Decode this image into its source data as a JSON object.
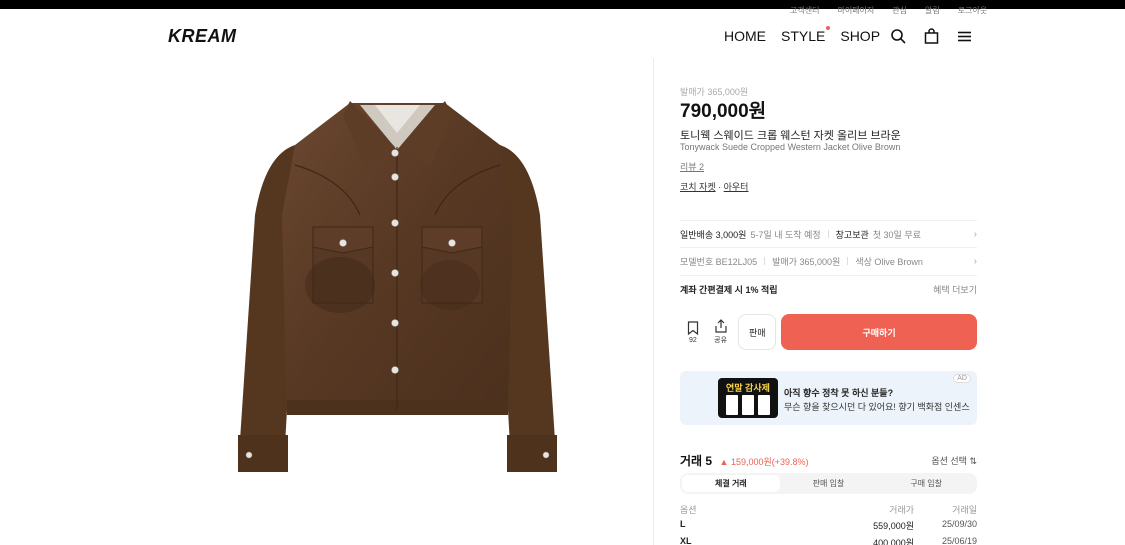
{
  "header": {
    "util_links": [
      "고객센터",
      "마이페이지",
      "관심",
      "알림",
      "로그아웃"
    ],
    "logo": "KREAM",
    "nav": [
      "HOME",
      "STYLE",
      "SHOP"
    ]
  },
  "product": {
    "release_price": "발매가 365,000원",
    "price": "790,000원",
    "name_ko": "토니웩 스웨이드 크롭 웨스턴 자켓 올리브 브라운",
    "name_en": "Tonywack Suede Cropped Western Jacket Olive Brown",
    "review": "리뷰 2",
    "category_1": "코치 자켓",
    "category_sep": " · ",
    "category_2": "아우터"
  },
  "shipping": {
    "label": "일반배송 3,000원",
    "eta": "5-7일 내 도착 예정",
    "warehouse_label": "창고보관",
    "warehouse_text": "첫 30일 무료"
  },
  "specs": {
    "model": "모델번호 BE12LJ05",
    "release": "발매가 365,000원",
    "color": "색상 Olive Brown"
  },
  "benefit": {
    "text": "계좌 간편결제 시 1% 적립",
    "more": "혜택 더보기"
  },
  "actions": {
    "wish_count": "92",
    "share_label": "공유",
    "sell_label": "판매",
    "buy_label": "구매하기"
  },
  "ad": {
    "badge": "AD",
    "thumb_title": "연말 감사제",
    "line1": "아직 향수 정착 못 하신 분들?",
    "line2": "무슨 향을 찾으시던 다 있어요! 향기 백화점 인센스"
  },
  "trade": {
    "title": "거래 5",
    "delta": "▲ 159,000원(+39.8%)",
    "option_select": "옵션 선택 ⇅",
    "tabs": [
      "체결 거래",
      "판매 입찰",
      "구매 입찰"
    ],
    "columns": [
      "옵션",
      "거래가",
      "거래일"
    ],
    "rows": [
      {
        "option": "L",
        "price": "559,000원",
        "date": "25/09/30"
      },
      {
        "option": "XL",
        "price": "400,000원",
        "date": "25/06/19"
      }
    ]
  },
  "colors": {
    "accent": "#ef6253",
    "jacket": "#5a3b24"
  },
  "icons": [
    "search-icon",
    "bag-icon",
    "menu-icon",
    "bookmark-icon",
    "share-icon",
    "chevron-right-icon"
  ]
}
